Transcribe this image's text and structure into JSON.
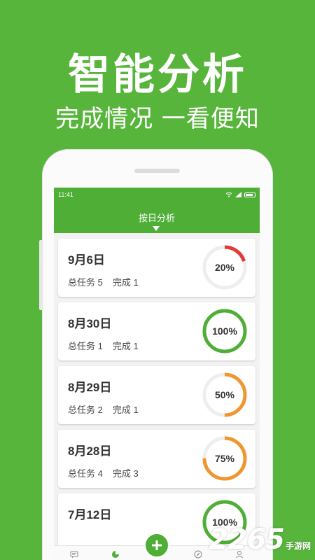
{
  "promo": {
    "headline": "智能分析",
    "subline": "完成情况 一看便知"
  },
  "statusbar": {
    "time": "11:41"
  },
  "appbar": {
    "title": "按日分析"
  },
  "stats_labels": {
    "total": "总任务",
    "done": "完成"
  },
  "cards": [
    {
      "date": "9月6日",
      "total": "总任务 5",
      "done": "完成 1",
      "percent_label": "20%",
      "percent": 20,
      "color": "#e53935"
    },
    {
      "date": "8月30日",
      "total": "总任务 1",
      "done": "完成 1",
      "percent_label": "100%",
      "percent": 100,
      "color": "#4fae36"
    },
    {
      "date": "8月29日",
      "total": "总任务 2",
      "done": "完成 1",
      "percent_label": "50%",
      "percent": 50,
      "color": "#f0962f"
    },
    {
      "date": "8月28日",
      "total": "总任务 4",
      "done": "完成 3",
      "percent_label": "75%",
      "percent": 75,
      "color": "#f0962f"
    },
    {
      "date": "7月12日",
      "total": "",
      "done": "",
      "percent_label": "100%",
      "percent": 100,
      "color": "#4fae36"
    }
  ],
  "tabs": [
    {
      "label": "待办",
      "icon": "chat-icon"
    },
    {
      "label": "图表",
      "icon": "pie-chart-icon",
      "active": true
    },
    {
      "label": "记事",
      "icon": "plus-icon"
    },
    {
      "label": "发现",
      "icon": "compass-icon"
    },
    {
      "label": "我的",
      "icon": "person-icon"
    }
  ],
  "watermark": {
    "number": "2265",
    "site": "手游网",
    "sub": "com"
  },
  "colors": {
    "brand_green": "#58b53b",
    "app_green": "#4fae36",
    "track_gray": "#eeeeee"
  }
}
